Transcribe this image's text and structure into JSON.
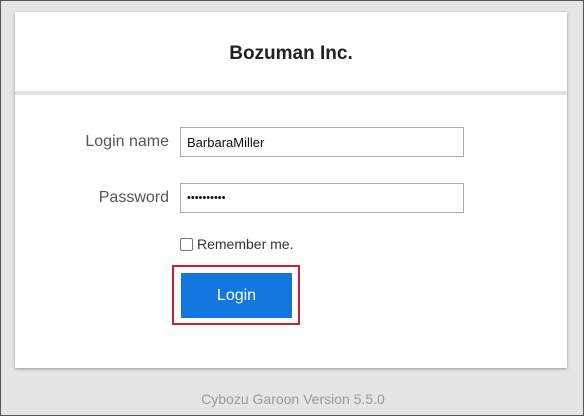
{
  "header": {
    "company_name": "Bozuman Inc."
  },
  "form": {
    "login_name_label": "Login name",
    "login_name_value": "BarbaraMiller",
    "password_label": "Password",
    "password_value": "••••••••••",
    "remember_label": "Remember me.",
    "remember_checked": false,
    "login_button_label": "Login"
  },
  "footer": {
    "version_text": "Cybozu Garoon Version 5.5.0"
  },
  "colors": {
    "button": "#1477e0",
    "highlight": "#cc1f2f",
    "background": "#e5e5e5"
  }
}
